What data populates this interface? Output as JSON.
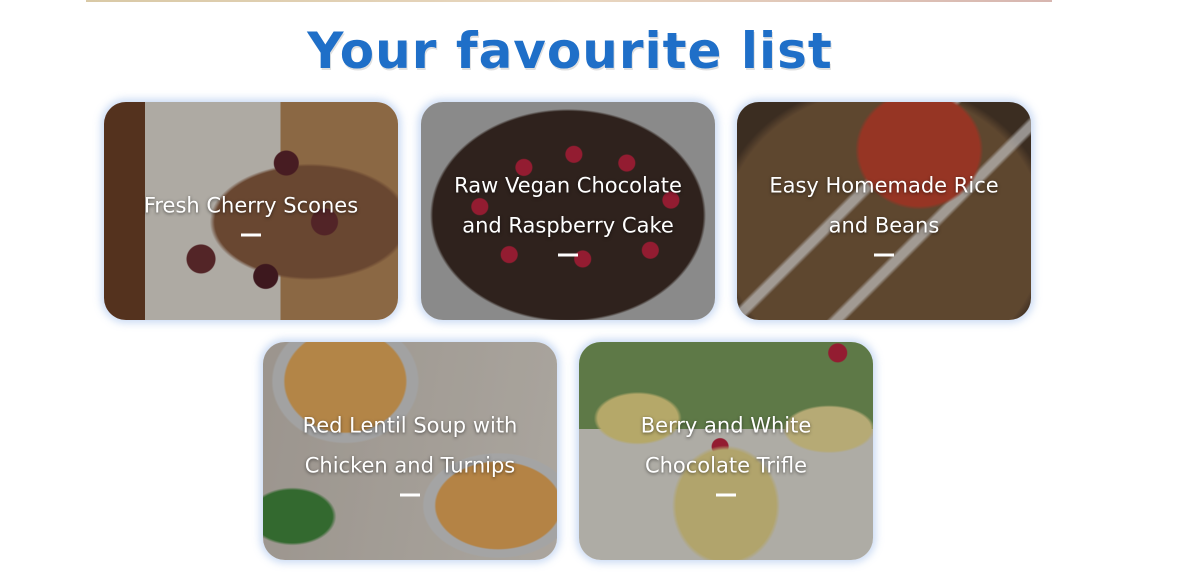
{
  "page": {
    "title": "Your favourite list"
  },
  "favourites": [
    {
      "line1": "Fresh Cherry Scones",
      "line2": ""
    },
    {
      "line1": "Raw Vegan Chocolate",
      "line2": "and Raspberry Cake"
    },
    {
      "line1": "Easy Homemade Rice",
      "line2": "and Beans"
    },
    {
      "line1": "Red Lentil Soup with",
      "line2": "Chicken and Turnips"
    },
    {
      "line1": "Berry and White",
      "line2": "Chocolate Trifle"
    }
  ],
  "colors": {
    "title": "#1f6fc8",
    "card_glow": "#8cafe6",
    "caption_text": "#ffffff"
  }
}
